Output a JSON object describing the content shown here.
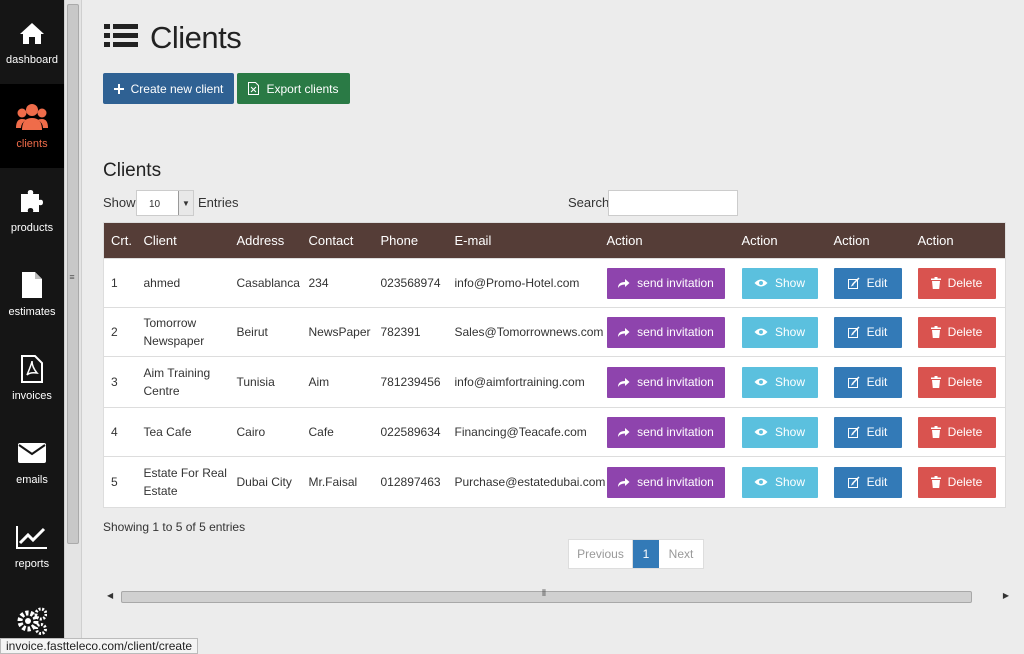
{
  "sidebar": {
    "items": [
      {
        "label": "dashboard",
        "icon": "home-icon"
      },
      {
        "label": "clients",
        "icon": "users-icon",
        "active": true
      },
      {
        "label": "products",
        "icon": "puzzle-icon"
      },
      {
        "label": "estimates",
        "icon": "file-icon"
      },
      {
        "label": "invoices",
        "icon": "pdf-icon"
      },
      {
        "label": "emails",
        "icon": "envelope-icon"
      },
      {
        "label": "reports",
        "icon": "chart-icon"
      },
      {
        "label": "",
        "icon": "gears-icon"
      }
    ]
  },
  "page": {
    "title": "Clients"
  },
  "toolbar": {
    "create_label": "Create new client",
    "export_label": "Export clients"
  },
  "table_section": {
    "title": "Clients",
    "show_label": "Show",
    "entries_value": "10",
    "entries_label": "Entries",
    "search_label": "Search:",
    "search_value": ""
  },
  "table": {
    "headers": [
      "Crt.",
      "Client",
      "Address",
      "Contact",
      "Phone",
      "E-mail",
      "Action",
      "Action",
      "Action",
      "Action"
    ],
    "rows": [
      {
        "crt": "1",
        "client": "ahmed",
        "address": "Casablanca",
        "contact": "234",
        "phone": "023568974",
        "email": "info@Promo-Hotel.com"
      },
      {
        "crt": "2",
        "client": "Tomorrow Newspaper",
        "address": "Beirut",
        "contact": "NewsPaper",
        "phone": "782391",
        "email": "Sales@Tomorrownews.com"
      },
      {
        "crt": "3",
        "client": "Aim Training Centre",
        "address": "Tunisia",
        "contact": "Aim",
        "phone": "781239456",
        "email": "info@aimfortraining.com"
      },
      {
        "crt": "4",
        "client": "Tea Cafe",
        "address": "Cairo",
        "contact": "Cafe",
        "phone": "022589634",
        "email": "Financing@Teacafe.com"
      },
      {
        "crt": "5",
        "client": "Estate For Real Estate",
        "address": "Dubai City",
        "contact": "Mr.Faisal",
        "phone": "012897463",
        "email": "Purchase@estatedubai.com"
      }
    ],
    "actions": {
      "invite": "send invitation",
      "show": "Show",
      "edit": "Edit",
      "delete": "Delete"
    }
  },
  "footer": {
    "info": "Showing 1 to 5 of 5 entries",
    "prev": "Previous",
    "page": "1",
    "next": "Next"
  },
  "statusbar": {
    "url": "invoice.fastteleco.com/client/create"
  },
  "colors": {
    "sidebar": "#151515",
    "active_label": "#ef6c4a",
    "table_header": "#553d37",
    "invite": "#8e44ad",
    "show": "#5bc0de",
    "edit": "#337ab7",
    "delete": "#d9534f",
    "create": "#2f6193",
    "export": "#2a7a45"
  }
}
